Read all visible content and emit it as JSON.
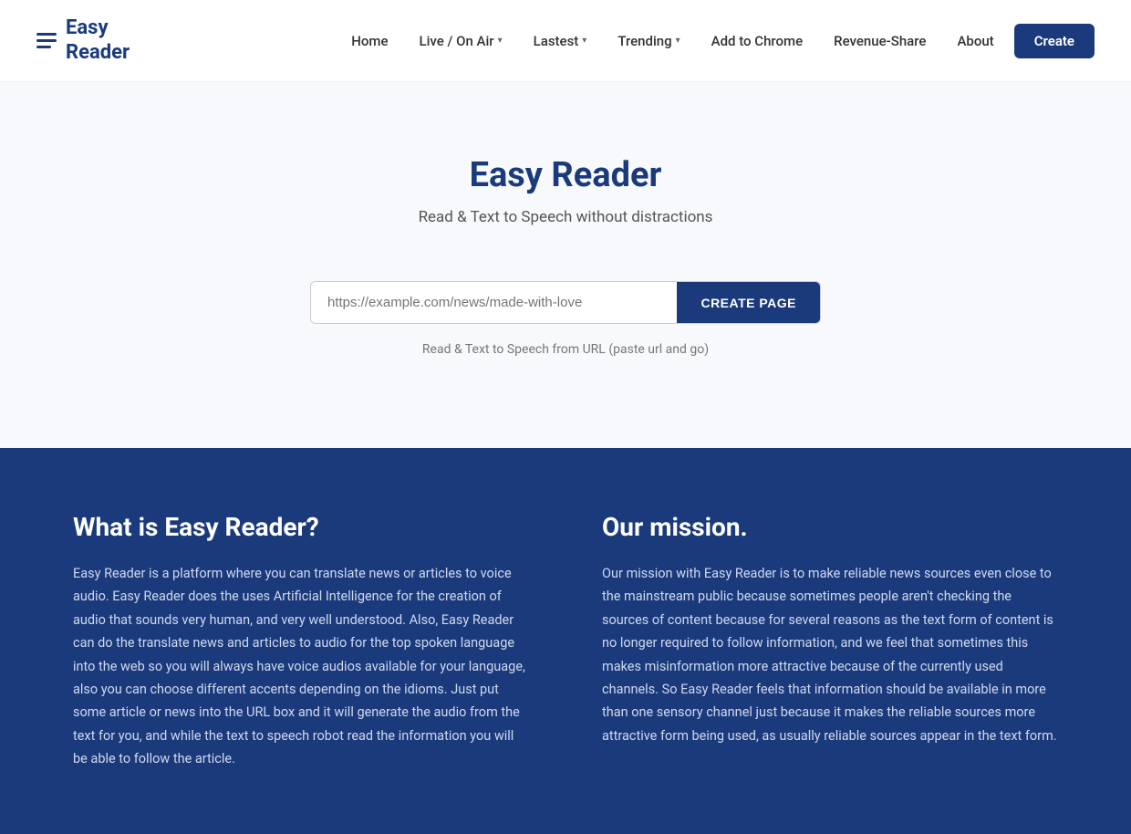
{
  "brand": {
    "name_line1": "Easy",
    "name_line2": "Reader"
  },
  "navbar": {
    "home_label": "Home",
    "live_label": "Live / On Air",
    "lastest_label": "Lastest",
    "trending_label": "Trending",
    "add_chrome_label": "Add to Chrome",
    "revenue_label": "Revenue-Share",
    "about_label": "About",
    "create_label": "Create"
  },
  "hero": {
    "title": "Easy Reader",
    "subtitle": "Read & Text to Speech without distractions",
    "input_placeholder": "https://example.com/news/made-with-love",
    "create_btn_label": "CREATE PAGE",
    "hint": "Read & Text to Speech from URL (paste url and go)"
  },
  "what_is": {
    "heading": "What is Easy Reader?",
    "body": "Easy Reader is a platform where you can translate news or articles to voice audio. Easy Reader does the uses Artificial Intelligence for the creation of audio that sounds very human, and very well understood. Also, Easy Reader can do the translate news and articles to audio for the top spoken language into the web so you will always have voice audios available for your language, also you can choose different accents depending on the idioms. Just put some article or news into the URL box and it will generate the audio from the text for you, and while the text to speech robot read the information you will be able to follow the article."
  },
  "mission": {
    "heading": "Our mission.",
    "body": "Our mission with Easy Reader is to make reliable news sources even close to the mainstream public because sometimes people aren't checking the sources of content because for several reasons as the text form of content is no longer required to follow information, and we feel that sometimes this makes misinformation more attractive because of the currently used channels. So Easy Reader feels that information should be available in more than one sensory channel just because it makes the reliable sources more attractive form being used, as usually reliable sources appear in the text form."
  }
}
